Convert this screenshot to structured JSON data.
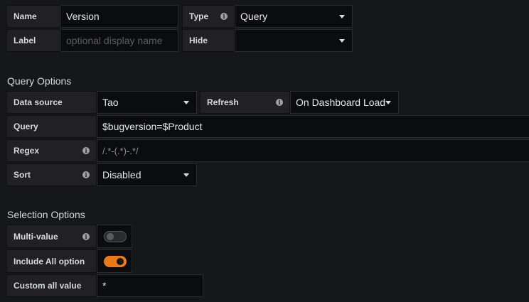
{
  "general": {
    "name_label": "Name",
    "name_value": "Version",
    "type_label": "Type",
    "type_value": "Query",
    "label_label": "Label",
    "label_placeholder": "optional display name",
    "hide_label": "Hide",
    "hide_value": ""
  },
  "query_options": {
    "title": "Query Options",
    "data_source_label": "Data source",
    "data_source_value": "Tao",
    "refresh_label": "Refresh",
    "refresh_value": "On Dashboard Load",
    "query_label": "Query",
    "query_value": "$bugversion=$Product",
    "regex_label": "Regex",
    "regex_value": "/.*-(.*)-.*/",
    "sort_label": "Sort",
    "sort_value": "Disabled"
  },
  "selection_options": {
    "title": "Selection Options",
    "multi_value_label": "Multi-value",
    "multi_value_on": false,
    "include_all_label": "Include All option",
    "include_all_on": true,
    "custom_all_label": "Custom all value",
    "custom_all_value": "*"
  },
  "colors": {
    "accent": "#eb7b18",
    "background": "#161719"
  },
  "icons": {
    "info": "info-icon",
    "dropdown": "caret-down-icon"
  }
}
